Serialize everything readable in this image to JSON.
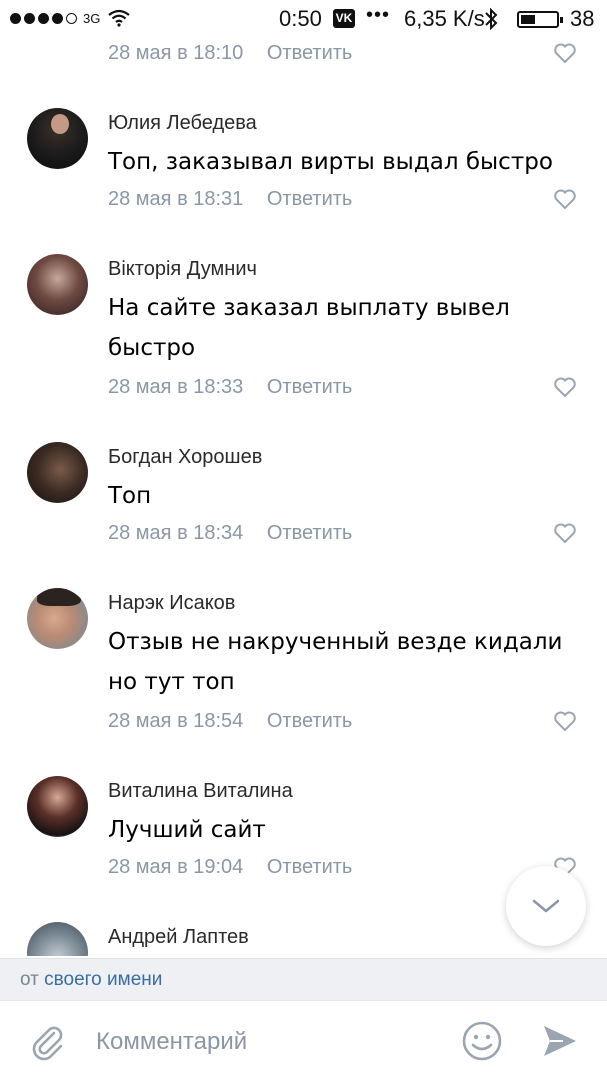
{
  "status_bar": {
    "network": "3G",
    "time": "0:50",
    "app_badge": "VK",
    "dots": "•••",
    "speed": "6,35 K/s",
    "battery": "38"
  },
  "comments": [
    {
      "author": "",
      "text": "",
      "date": "28 мая в 18:10",
      "reply": "Ответить"
    },
    {
      "author": "Юлия Лебедева",
      "text": "Топ, заказывал вирты выдал быстро",
      "date": "28 мая в 18:31",
      "reply": "Ответить"
    },
    {
      "author": "Вікторія Думнич",
      "text": "На сайте заказал выплату вывел быстро",
      "date": "28 мая в 18:33",
      "reply": "Ответить"
    },
    {
      "author": "Богдан Хорошев",
      "text": "Топ",
      "date": "28 мая в 18:34",
      "reply": "Ответить"
    },
    {
      "author": "Нарэк Исаков",
      "text": "Отзыв не накрученный везде кидали но тут топ",
      "date": "28 мая в 18:54",
      "reply": "Ответить"
    },
    {
      "author": "Виталина Виталина",
      "text": "Лучший сайт",
      "date": "28 мая в 19:04",
      "reply": "Ответить"
    },
    {
      "author": "Андрей Лаптев",
      "text": "",
      "date": "",
      "reply": ""
    }
  ],
  "from_bar": {
    "prefix": "от",
    "link": "своего имени"
  },
  "input": {
    "placeholder": "Комментарий"
  },
  "colors": {
    "meta": "#8b97a5",
    "link": "#3a6ea3",
    "icon": "#9aa5b1"
  }
}
